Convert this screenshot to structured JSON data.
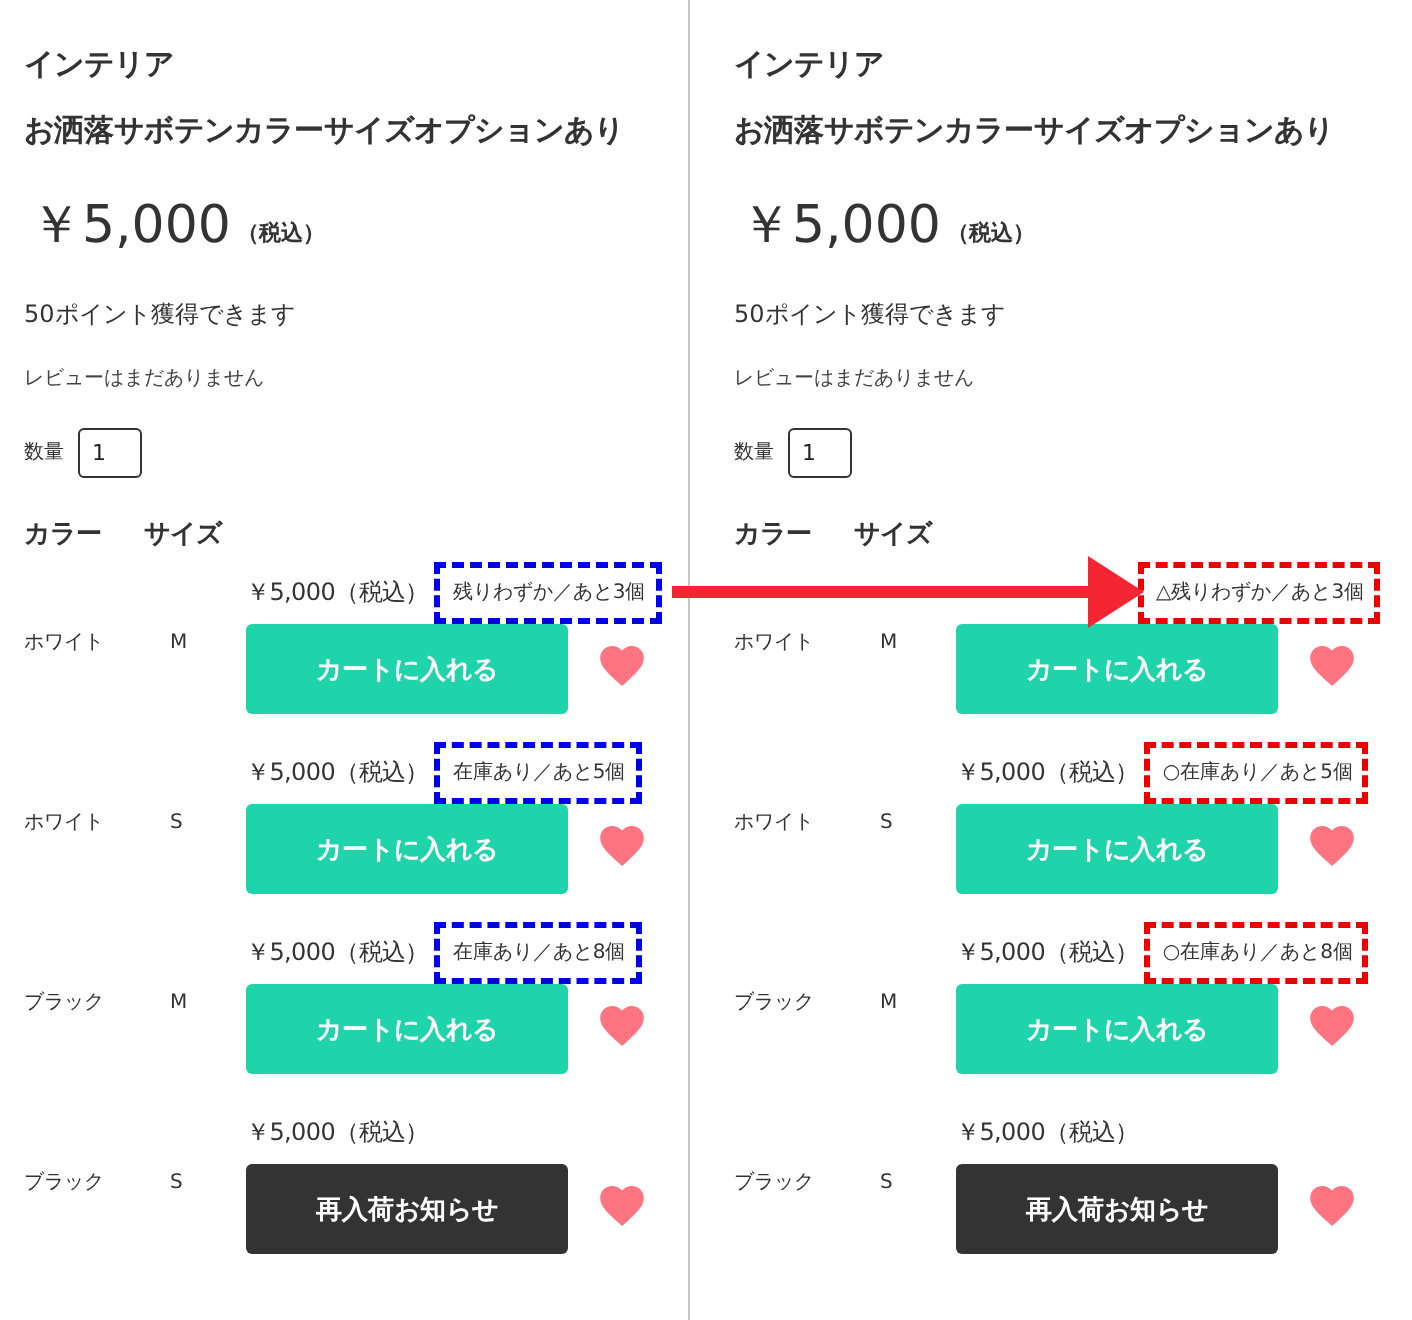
{
  "panels": [
    {
      "color": "#0000ee",
      "category": "インテリア",
      "title": "お洒落サボテンカラーサイズオプションあり",
      "price": "￥5,000",
      "tax_note": "（税込）",
      "points": "50ポイント獲得できます",
      "reviews": "レビューはまだありません",
      "quantity": {
        "label": "数量",
        "value": "1"
      },
      "columns": [
        "カラー",
        "サイズ"
      ],
      "variants": [
        {
          "color_name": "ホワイト",
          "size": "M",
          "price": "￥5,000（税込）",
          "stock": "残りわずか／あと3個",
          "button": {
            "kind": "cart",
            "label": "カートに入れる"
          }
        },
        {
          "color_name": "ホワイト",
          "size": "S",
          "price": "￥5,000（税込）",
          "stock": "在庫あり／あと5個",
          "button": {
            "kind": "cart",
            "label": "カートに入れる"
          }
        },
        {
          "color_name": "ブラック",
          "size": "M",
          "price": "￥5,000（税込）",
          "stock": "在庫あり／あと8個",
          "button": {
            "kind": "cart",
            "label": "カートに入れる"
          }
        },
        {
          "color_name": "ブラック",
          "size": "S",
          "price": "￥5,000（税込）",
          "button": {
            "kind": "restock",
            "label": "再入荷お知らせ"
          }
        }
      ]
    },
    {
      "color": "#ee0000",
      "category": "インテリア",
      "title": "お洒落サボテンカラーサイズオプションあり",
      "price": "￥5,000",
      "tax_note": "（税込）",
      "points": "50ポイント獲得できます",
      "reviews": "レビューはまだありません",
      "quantity": {
        "label": "数量",
        "value": "1"
      },
      "columns": [
        "カラー",
        "サイズ"
      ],
      "variants": [
        {
          "color_name": "ホワイト",
          "size": "M",
          "stock": "△残りわずか／あと3個",
          "button": {
            "kind": "cart",
            "label": "カートに入れる"
          }
        },
        {
          "color_name": "ホワイト",
          "size": "S",
          "price": "￥5,000（税込）",
          "stock": "○在庫あり／あと5個",
          "button": {
            "kind": "cart",
            "label": "カートに入れる"
          }
        },
        {
          "color_name": "ブラック",
          "size": "M",
          "price": "￥5,000（税込）",
          "stock": "○在庫あり／あと8個",
          "button": {
            "kind": "cart",
            "label": "カートに入れる"
          }
        },
        {
          "color_name": "ブラック",
          "size": "S",
          "price": "￥5,000（税込）",
          "button": {
            "kind": "restock",
            "label": "再入荷お知らせ"
          }
        }
      ]
    }
  ]
}
